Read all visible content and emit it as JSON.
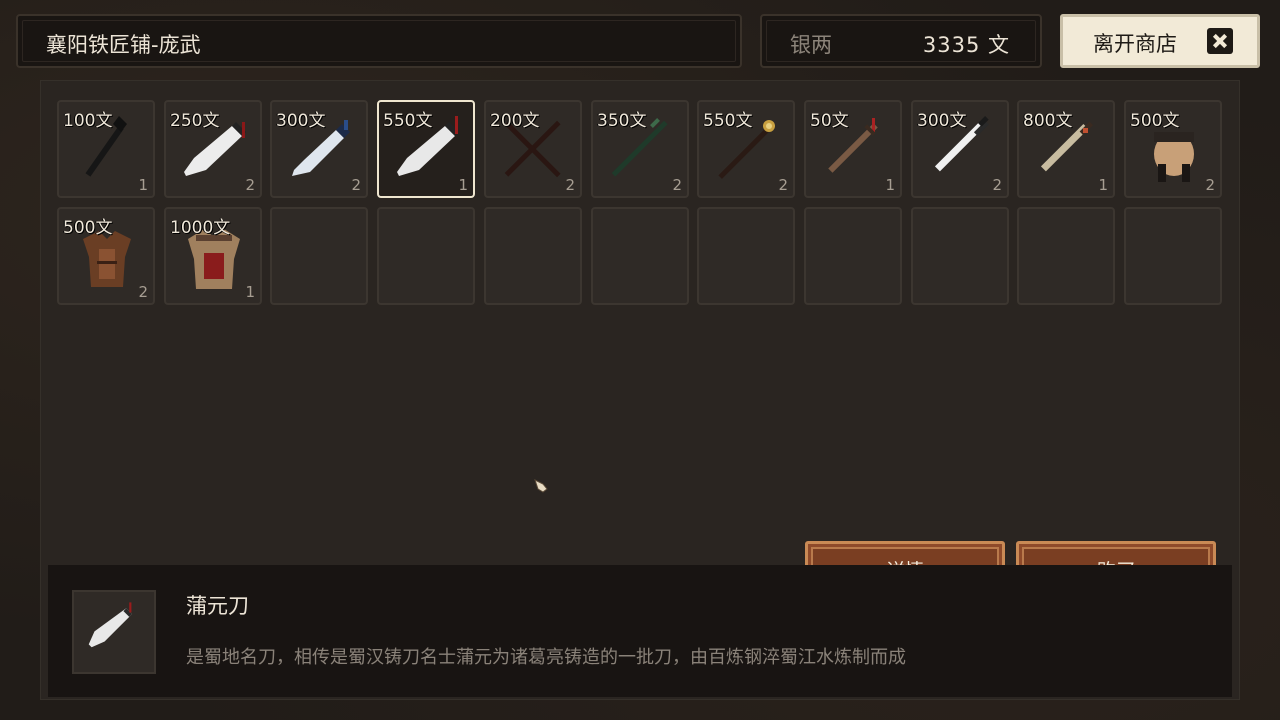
{
  "shop": {
    "title": "襄阳铁匠铺-庞武"
  },
  "currency": {
    "label": "银两",
    "value": "3335 文"
  },
  "leave_button": {
    "label": "离开商店",
    "icon": "close-icon"
  },
  "items": [
    {
      "price": "100文",
      "qty": "1",
      "icon": "dark-spear-icon"
    },
    {
      "price": "250文",
      "qty": "2",
      "icon": "broad-blade-icon"
    },
    {
      "price": "300文",
      "qty": "2",
      "icon": "blue-hilt-blade-icon"
    },
    {
      "price": "550文",
      "qty": "1",
      "icon": "red-tassel-blade-icon",
      "selected": true
    },
    {
      "price": "200文",
      "qty": "2",
      "icon": "crossed-staves-icon"
    },
    {
      "price": "350文",
      "qty": "2",
      "icon": "green-staff-icon"
    },
    {
      "price": "550文",
      "qty": "2",
      "icon": "golden-mace-icon"
    },
    {
      "price": "50文",
      "qty": "1",
      "icon": "wooden-sword-icon"
    },
    {
      "price": "300文",
      "qty": "2",
      "icon": "white-sword-icon"
    },
    {
      "price": "800文",
      "qty": "1",
      "icon": "bronze-sword-icon"
    },
    {
      "price": "500文",
      "qty": "2",
      "icon": "cloth-armor-icon"
    },
    {
      "price": "500文",
      "qty": "2",
      "icon": "leather-armor-icon"
    },
    {
      "price": "1000文",
      "qty": "1",
      "icon": "red-sash-armor-icon"
    }
  ],
  "detail": {
    "name": "蒲元刀",
    "description": "是蜀地名刀，相传是蜀汉铸刀名士蒲元为诸葛亮铸造的一批刀，由百炼钢淬蜀江水炼制而成",
    "icon": "red-tassel-blade-icon"
  },
  "actions": {
    "details_label": "详情",
    "buy_label": "购买"
  },
  "colors": {
    "accent": "#7a3e22",
    "accent_border": "#c98a55",
    "selected_border": "#efe6cf",
    "leave_bg": "#f2ead7"
  }
}
